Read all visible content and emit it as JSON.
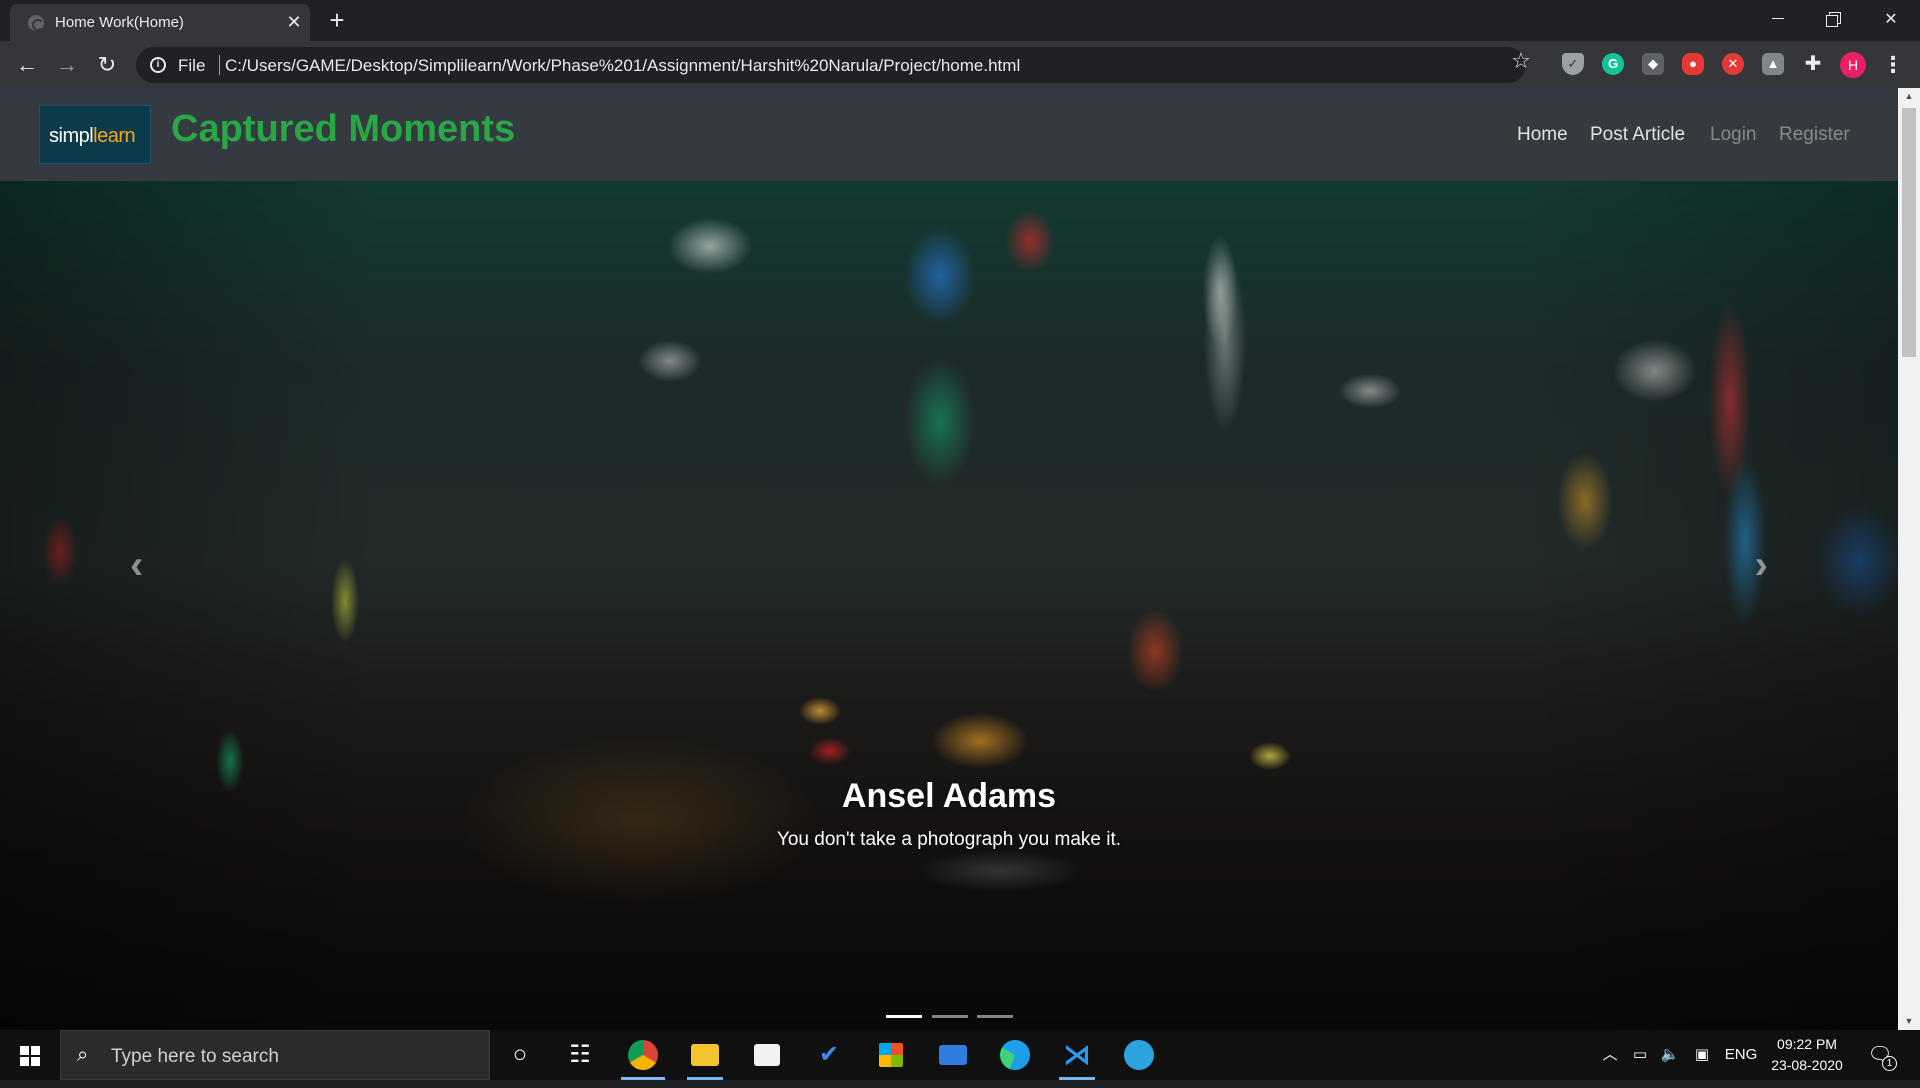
{
  "browser": {
    "tab_title": "Home Work(Home)",
    "scheme_label": "File",
    "url": "C:/Users/GAME/Desktop/Simplilearn/Work/Phase%201/Assignment/Harshit%20Narula/Project/home.html",
    "profile_initial": "H"
  },
  "site": {
    "logo_text_prefix": "simpl",
    "logo_text_suffix": "learn",
    "title": "Captured Moments",
    "nav": {
      "home": "Home",
      "post_article": "Post Article",
      "login": "Login",
      "register": "Register"
    }
  },
  "carousel": {
    "caption_title": "Ansel Adams",
    "caption_text": "You don't take a photograph you make it.",
    "active_slide": 1,
    "slide_count": 3
  },
  "taskbar": {
    "search_placeholder": "Type here to search",
    "language": "ENG",
    "time": "09:22 PM",
    "date": "23-08-2020",
    "notification_count": "1"
  },
  "colors": {
    "brand_title": "#28a745",
    "navbar_bg": "#343a40",
    "logo_accent": "#f5a623"
  }
}
